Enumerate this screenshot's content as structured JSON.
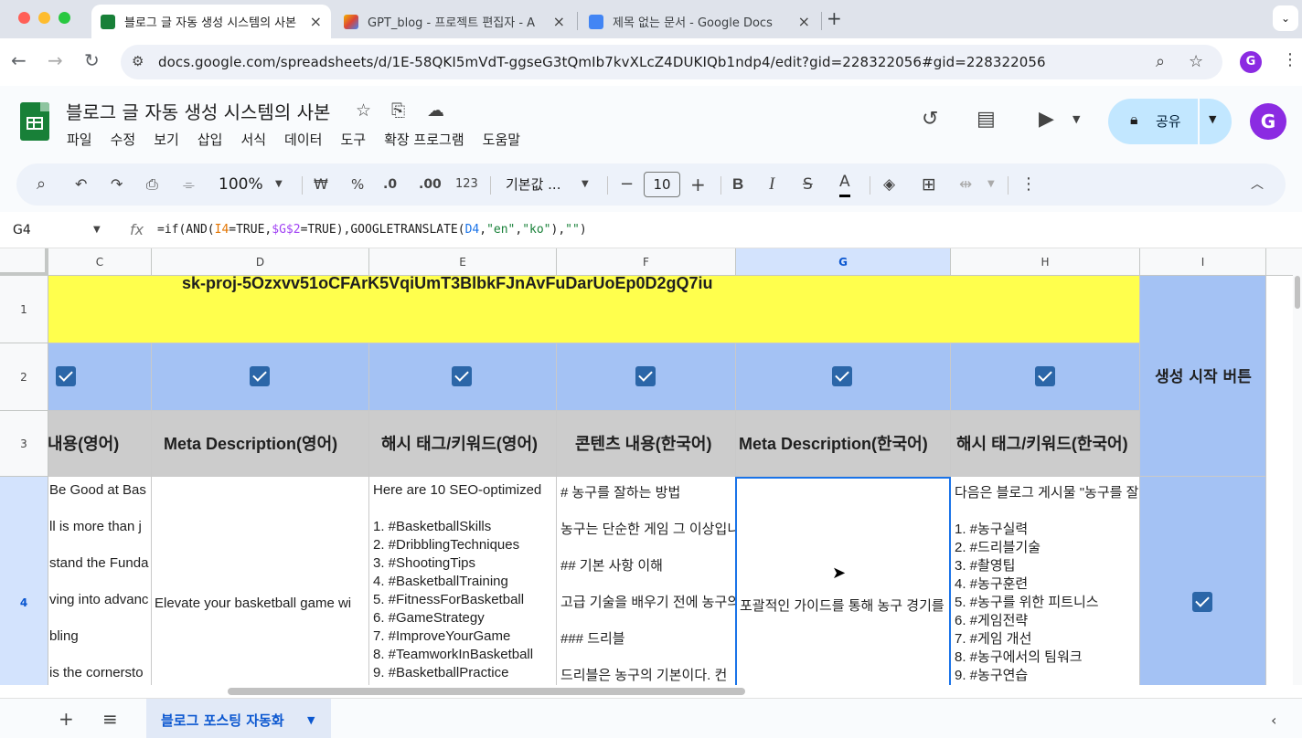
{
  "browser": {
    "tabs": [
      {
        "title": "블로그 글 자동 생성 시스템의 사본",
        "active": true
      },
      {
        "title": "GPT_blog - 프로젝트 편집자 - A",
        "active": false
      },
      {
        "title": "제목 없는 문서 - Google Docs",
        "active": false
      }
    ],
    "url": "docs.google.com/spreadsheets/d/1E-58QKI5mVdT-ggseG3tQmIb7kvXLcZ4DUKIQb1ndp4/edit?gid=228322056#gid=228322056",
    "profile_initial": "G"
  },
  "sheets": {
    "title": "블로그 글 자동 생성 시스템의 사본",
    "menus": [
      "파일",
      "수정",
      "보기",
      "삽입",
      "서식",
      "데이터",
      "도구",
      "확장 프로그램",
      "도움말"
    ],
    "share_label": "공유",
    "avatar_initial": "G"
  },
  "toolbar": {
    "zoom": "100%",
    "currency": "₩",
    "percent": "%",
    "dec_decrease": ".0",
    "dec_increase": ".00",
    "number_format": "123",
    "font": "기본값 ...",
    "font_size": "10",
    "bold": "B",
    "italic": "I",
    "text_color_glyph": "A"
  },
  "formula_bar": {
    "cell_ref": "G4",
    "fx": "fx",
    "parts": [
      "=if(AND(",
      "I4",
      "=TRUE,",
      "$G$2",
      "=TRUE),GOOGLETRANSLATE(",
      "D4",
      ",",
      "\"en\"",
      ",",
      "\"ko\"",
      "),",
      "\"\"",
      ")"
    ]
  },
  "grid": {
    "columns": [
      "C",
      "D",
      "E",
      "F",
      "G",
      "H",
      "I"
    ],
    "selected_column": "G",
    "rows": [
      "1",
      "2",
      "3",
      "4"
    ],
    "selected_row": "4",
    "row1_api_key": "sk-proj-5Ozxvv51oCFArK5VqiUmT3BlbkFJnAvFuDarUoEp0D2gQ7iu",
    "row2_checked": [
      true,
      true,
      true,
      true,
      true,
      true
    ],
    "generate_button_label": "생성 시작 버튼",
    "row3_headers": ": 내용(영어)",
    "headers": {
      "C": ": 내용(영어)",
      "D": "Meta Description(영어)",
      "E": "해시 태그/키워드(영어)",
      "F": "콘텐츠 내용(한국어)",
      "G": "Meta Description(한국어)",
      "H": "해시 태그/키워드(한국어)"
    },
    "row4": {
      "C": [
        "Be Good at Bas",
        "ll is more than j",
        "stand the Funda",
        "ving into advanc",
        "bling",
        "is the cornersto"
      ],
      "D": "Elevate your basketball game wi",
      "E": [
        "Here are 10 SEO-optimized",
        "",
        "1. #BasketballSkills",
        "2. #DribblingTechniques",
        "3. #ShootingTips",
        "4. #BasketballTraining",
        "5. #FitnessForBasketball",
        "6. #GameStrategy",
        "7. #ImproveYourGame",
        "8. #TeamworkInBasketball",
        "9. #BasketballPractice"
      ],
      "F": [
        "# 농구를 잘하는 방법",
        "농구는 단순한 게임 그 이상입니",
        "## 기본 사항 이해",
        "고급 기술을 배우기 전에 농구의",
        "### 드리블",
        "드리블은 농구의 기본이다. 컨"
      ],
      "G": "포괄적인 가이드를 통해 농구 경기를",
      "H": [
        "다음은 블로그 게시물 \"농구를 잘",
        "",
        "1. #농구실력",
        "2. #드리블기술",
        "3. #촬영팁",
        "4. #농구훈련",
        "5. #농구를 위한 피트니스",
        "6. #게임전략",
        "7. #게임 개선",
        "8. #농구에서의 팀워크",
        "9. #농구연습"
      ],
      "I_checked": true
    }
  },
  "sheet_tabs": {
    "active": "블로그 포스팅 자동화"
  },
  "colors": {
    "row1": "#ffff4d",
    "row2": "#a4c2f4",
    "row3": "#cccccc",
    "checkbox": "#2b66a8",
    "selection": "#1a73e8"
  }
}
